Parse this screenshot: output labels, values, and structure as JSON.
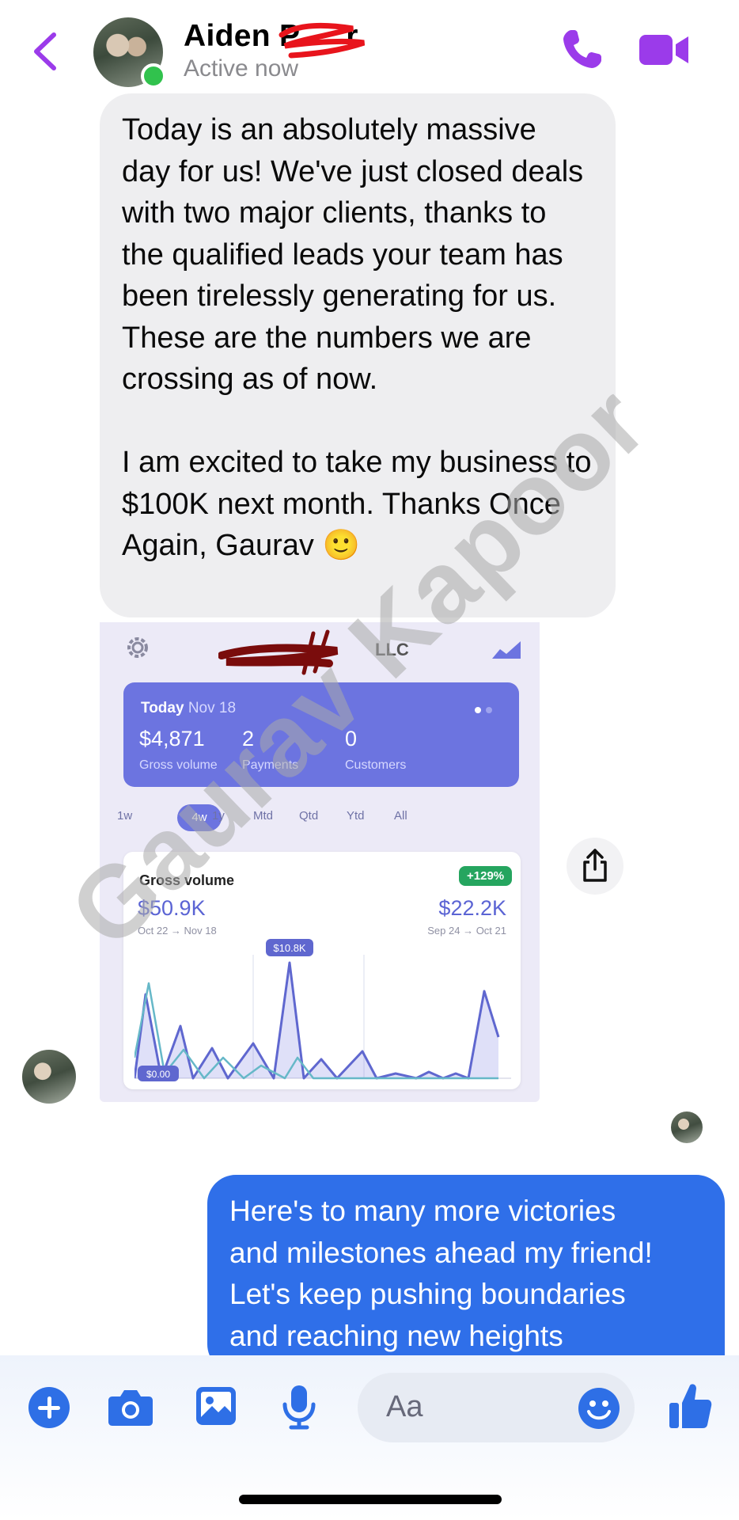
{
  "header": {
    "contact_name": "Aiden P",
    "name_suffix": "r",
    "status": "Active now"
  },
  "incoming_message": {
    "text": "Today is an absolutely massive day for us! We've just closed deals with two major clients, thanks to the qualified leads your team has been tirelessly generating for us. These are the numbers we are crossing as of now.\n\nI am excited to take my business to $100K next month. Thanks Once Again, Gaurav 🙂"
  },
  "attachment": {
    "company_suffix": "LLC",
    "today": {
      "label": "Today",
      "date": "Nov 18",
      "gross_volume_value": "$4,871",
      "gross_volume_label": "Gross volume",
      "payments_value": "2",
      "payments_label": "Payments",
      "customers_value": "0",
      "customers_label": "Customers"
    },
    "ranges": [
      "1w",
      "4w",
      "1y",
      "Mtd",
      "Qtd",
      "Ytd",
      "All"
    ],
    "active_range": "4w",
    "gross_volume": {
      "title": "Gross volume",
      "change_badge": "+129%",
      "current_value": "$50.9K",
      "current_range": "Oct 22 → Nov 18",
      "previous_value": "$22.2K",
      "previous_range": "Sep 24 → Oct 21",
      "peak_label": "$10.8K",
      "min_label": "$0.00"
    }
  },
  "watermark": "Gaurav Kapoor",
  "outgoing_message": {
    "text": "Here's to many more victories\nand milestones ahead my friend!\nLet's keep pushing boundaries\nand reaching new heights"
  },
  "composer": {
    "placeholder": "Aa"
  },
  "colors": {
    "accent_purple": "#9b3bea",
    "messenger_blue": "#2f6fe9",
    "incoming_bubble": "#eeeef0",
    "online_green": "#31c24d",
    "dashboard_indigo": "#6c74e0"
  },
  "icons": [
    "back-chevron-icon",
    "phone-icon",
    "video-camera-icon",
    "share-icon",
    "plus-icon",
    "camera-icon",
    "image-icon",
    "microphone-icon",
    "emoji-icon",
    "thumbs-up-icon",
    "settings-icon",
    "trend-icon"
  ]
}
